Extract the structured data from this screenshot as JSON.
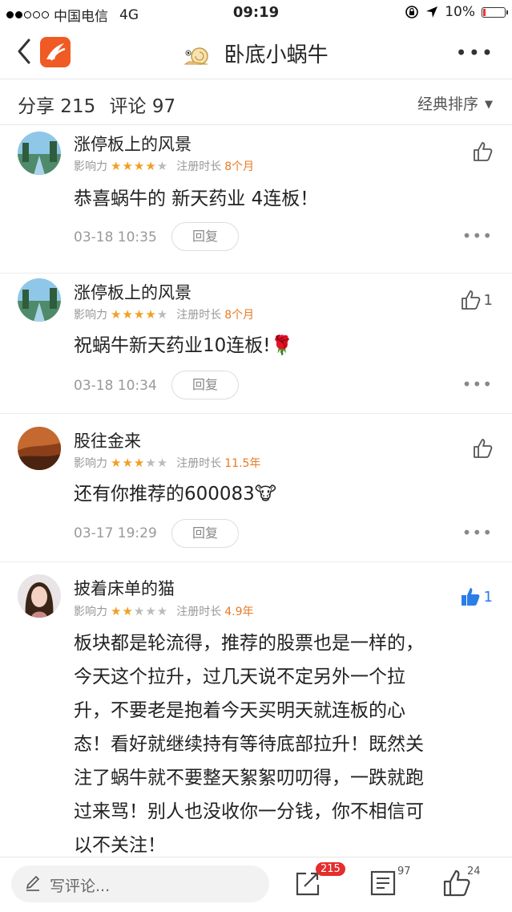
{
  "status": {
    "carrier": "中国电信",
    "network": "4G",
    "time": "09:19",
    "battery": "10%"
  },
  "nav": {
    "title": "卧底小蜗牛",
    "more": "•••"
  },
  "subbar": {
    "share": "分享 215",
    "comment": "评论 97",
    "sort": "经典排序"
  },
  "labels": {
    "influence": "影响力",
    "reg": "注册时长",
    "reply": "回复"
  },
  "comments": [
    {
      "user": "涨停板上的风景",
      "stars": 4.5,
      "duration": "8个月",
      "text": "恭喜蜗牛的 新天药业 4连板！",
      "time": "03-18 10:35",
      "likes": "",
      "liked": false,
      "has_reply": true
    },
    {
      "user": "涨停板上的风景",
      "stars": 4.5,
      "duration": "8个月",
      "text": "祝蜗牛新天药业10连板!🌹",
      "time": "03-18 10:34",
      "likes": "1",
      "liked": false,
      "has_reply": true
    },
    {
      "user": "股往金来",
      "stars": 3.5,
      "duration": "11.5年",
      "text": "还有你推荐的600083🐮",
      "time": "03-17 19:29",
      "likes": "",
      "liked": false,
      "has_reply": true
    },
    {
      "user": "披着床单的猫",
      "stars": 2,
      "duration": "4.9年",
      "text_lines": [
        "板块都是轮流得，推荐的股票也是一样的，",
        "今天这个拉升，过几天说不定另外一个拉",
        "升，不要老是抱着今天买明天就连板的心",
        "态！看好就继续持有等待底部拉升！既然关",
        "注了蜗牛就不要整天絮絮叨叨得，一跌就跑",
        "过来骂！别人也没收你一分钱，你不相信可",
        "以不关注！"
      ],
      "likes": "1",
      "liked": true
    }
  ],
  "bottom": {
    "placeholder": "写评论...",
    "share_count": "215",
    "comment_count": "97",
    "like_count": "24"
  },
  "colors": {
    "accent": "#f05a24",
    "star": "#f0a022",
    "duration": "#e87a22",
    "like_active": "#2b7de9",
    "badge": "#e52d2d"
  }
}
